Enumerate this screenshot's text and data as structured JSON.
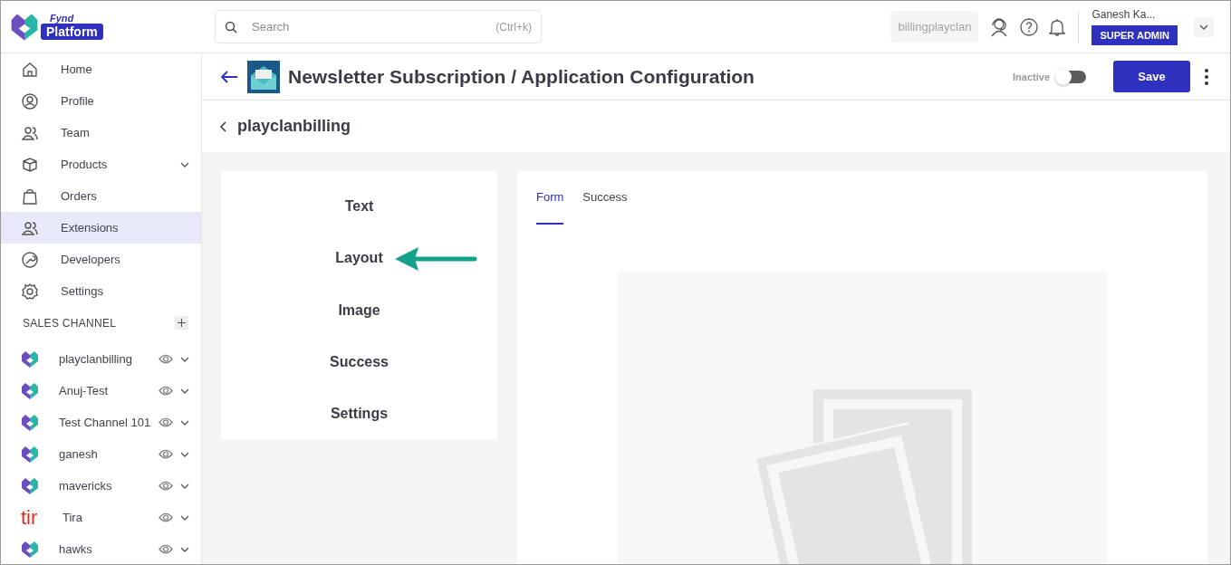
{
  "header": {
    "logo": {
      "brand_top": "Fynd",
      "brand_badge": "Platform"
    },
    "search": {
      "placeholder": "Search",
      "shortcut": "(Ctrl+k)"
    },
    "company_chip": "billingplayclan",
    "user": {
      "name": "Ganesh Ka...",
      "role": "SUPER ADMIN"
    }
  },
  "sidebar": {
    "items": [
      {
        "label": "Home",
        "selected": false,
        "expandable": false
      },
      {
        "label": "Profile",
        "selected": false,
        "expandable": false
      },
      {
        "label": "Team",
        "selected": false,
        "expandable": false
      },
      {
        "label": "Products",
        "selected": false,
        "expandable": true
      },
      {
        "label": "Orders",
        "selected": false,
        "expandable": false
      },
      {
        "label": "Extensions",
        "selected": true,
        "expandable": false
      },
      {
        "label": "Developers",
        "selected": false,
        "expandable": false
      },
      {
        "label": "Settings",
        "selected": false,
        "expandable": false
      }
    ],
    "section_title": "SALES CHANNEL",
    "channels": [
      {
        "name": "playclanbilling",
        "kind": "fynd"
      },
      {
        "name": "Anuj-Test",
        "kind": "fynd"
      },
      {
        "name": "Test Channel 101",
        "kind": "fynd"
      },
      {
        "name": "ganesh",
        "kind": "fynd"
      },
      {
        "name": "mavericks",
        "kind": "fynd"
      },
      {
        "name": "Tira",
        "kind": "text",
        "logo_text": "tir"
      },
      {
        "name": "hawks",
        "kind": "fynd"
      }
    ]
  },
  "page": {
    "title": "Newsletter Subscription / Application Configuration",
    "status_label": "Inactive",
    "active": false,
    "save": "Save",
    "breadcrumb": "playclanbilling"
  },
  "menu": [
    {
      "label": "Text",
      "pointed": false
    },
    {
      "label": "Layout",
      "pointed": true
    },
    {
      "label": "Image",
      "pointed": false
    },
    {
      "label": "Success",
      "pointed": false
    },
    {
      "label": "Settings",
      "pointed": false
    }
  ],
  "tabs": [
    {
      "label": "Form",
      "selected": true
    },
    {
      "label": "Success",
      "selected": false
    }
  ]
}
